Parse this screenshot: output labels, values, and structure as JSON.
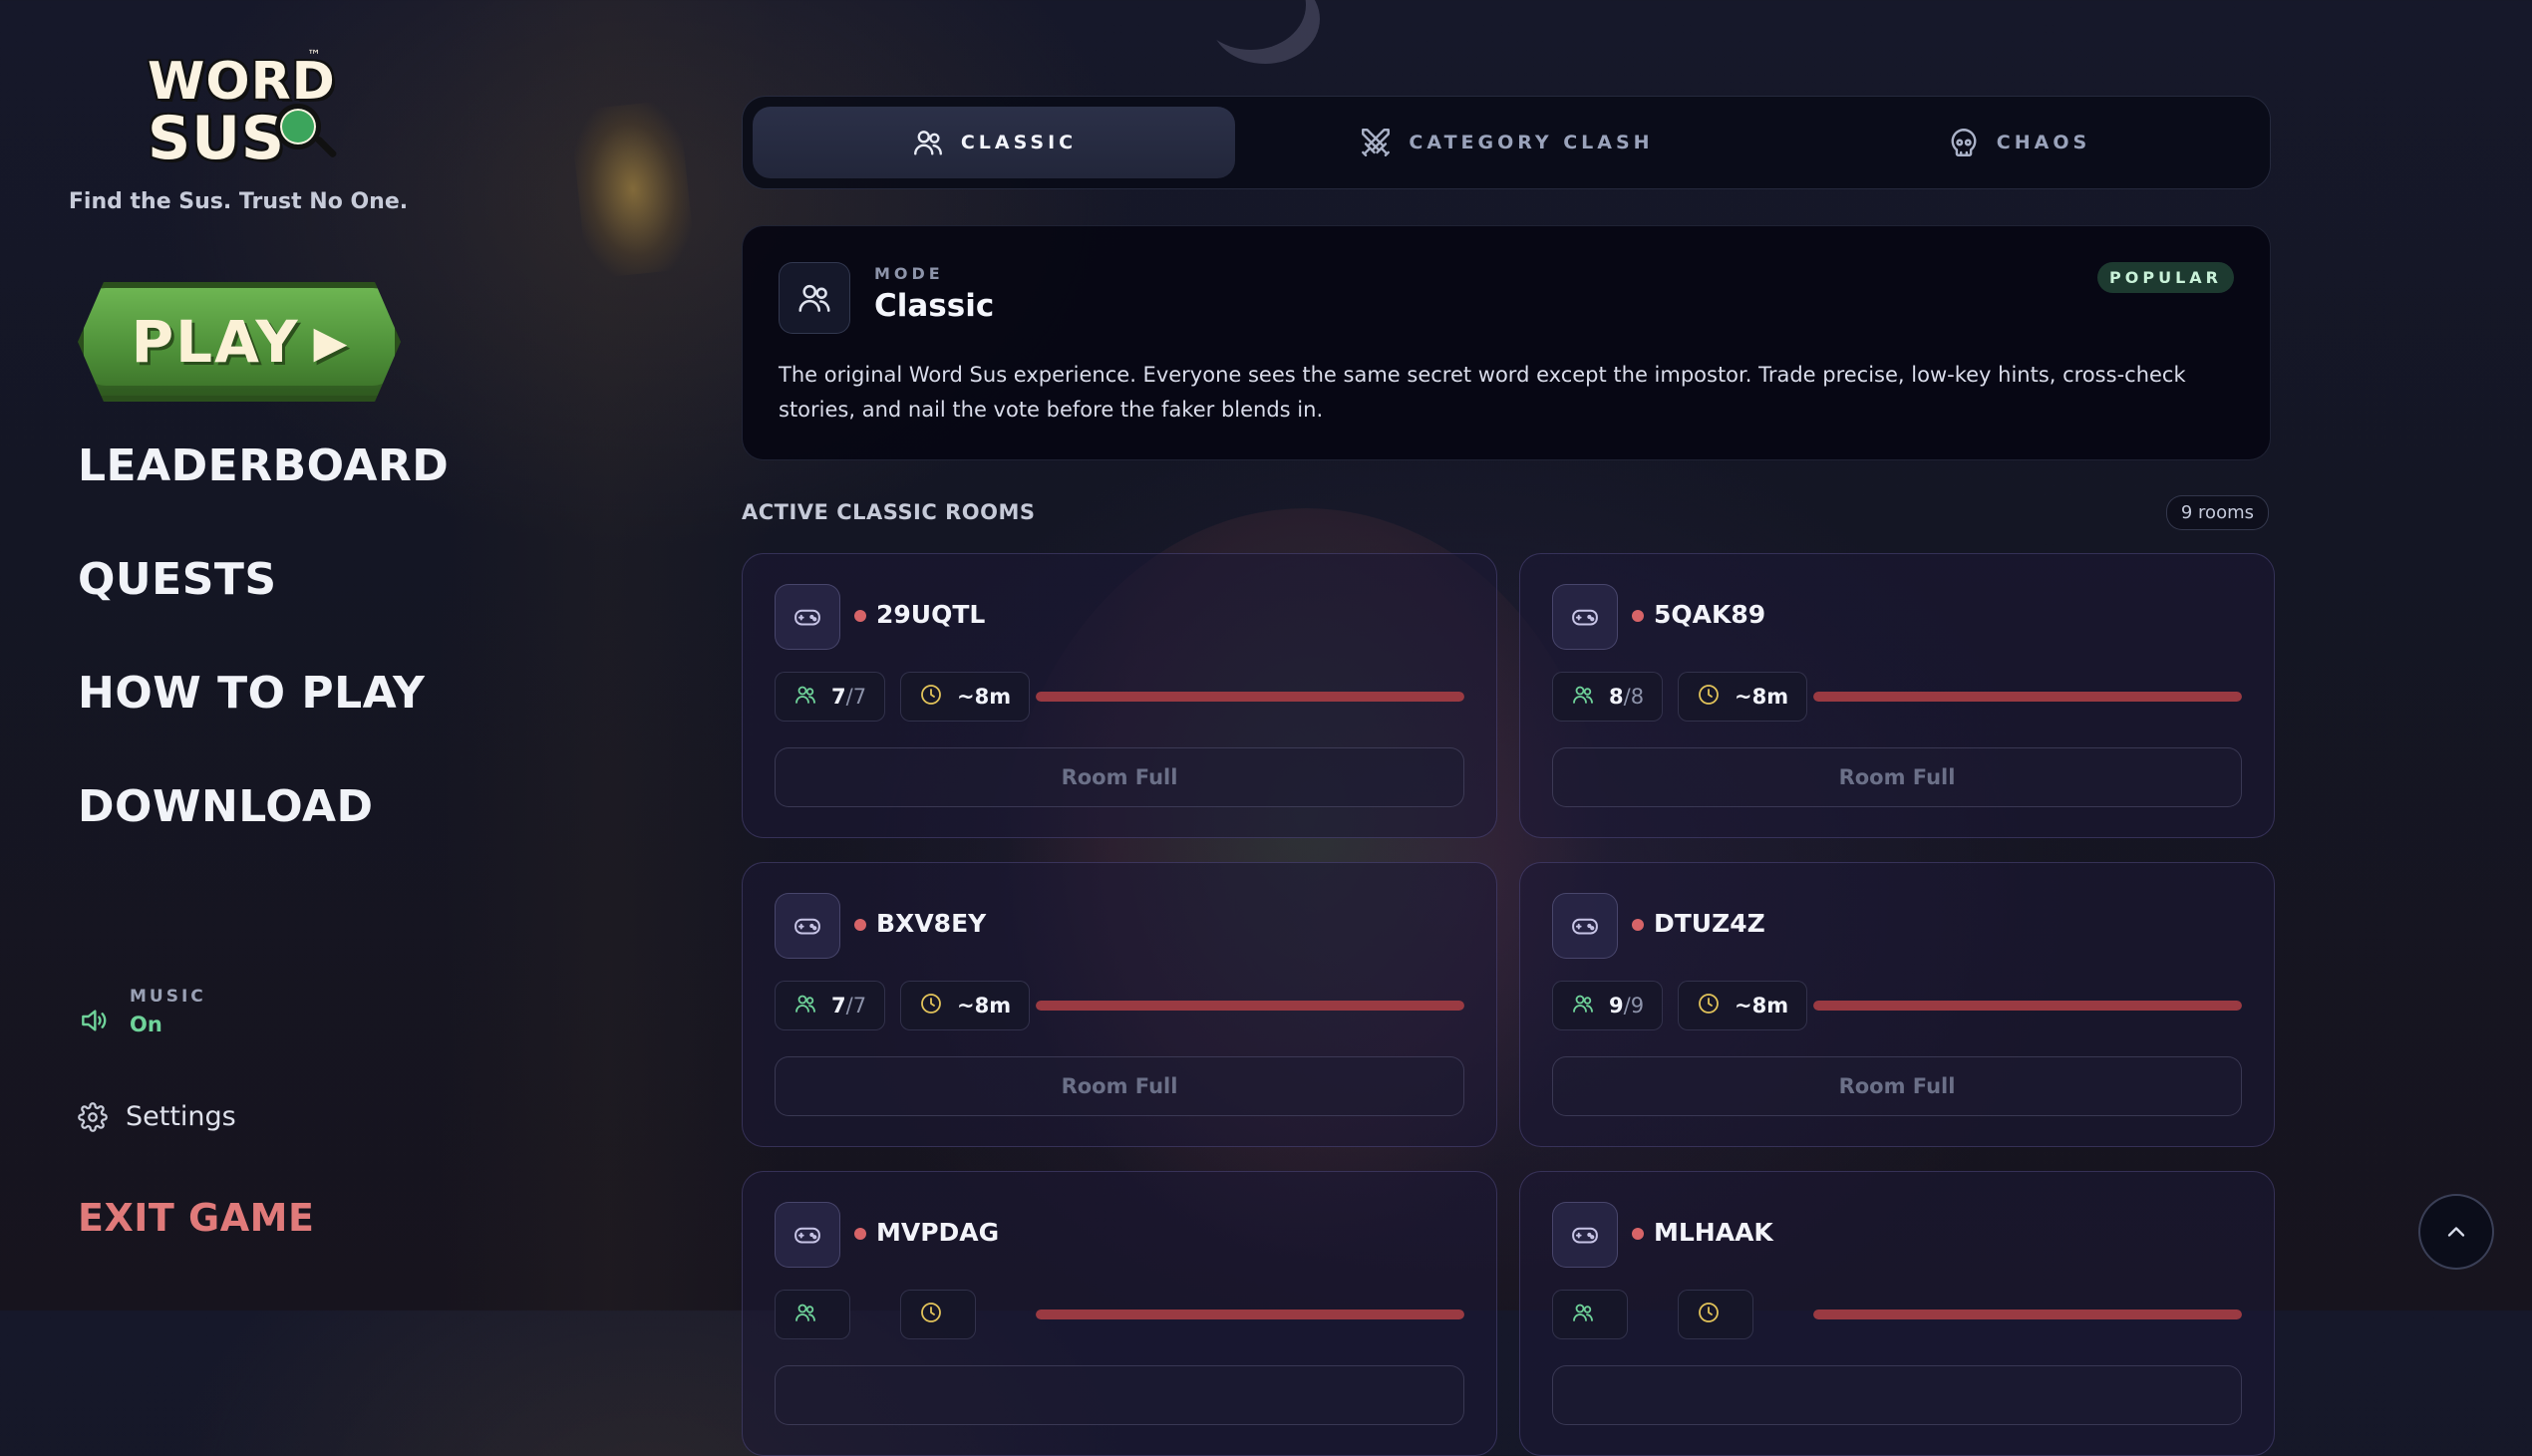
{
  "brand": {
    "logo_line1": "WORD",
    "logo_line2": "SUS",
    "tagline": "Find the Sus. Trust No One."
  },
  "sidebar": {
    "play_label": "PLAY",
    "nav": [
      {
        "label": "LEADERBOARD"
      },
      {
        "label": "QUESTS"
      },
      {
        "label": "HOW TO PLAY"
      },
      {
        "label": "DOWNLOAD"
      }
    ],
    "music": {
      "label": "MUSIC",
      "value": "On"
    },
    "settings_label": "Settings",
    "exit_label": "EXIT GAME"
  },
  "tabs": [
    {
      "label": "CLASSIC",
      "icon": "users-icon",
      "active": true
    },
    {
      "label": "CATEGORY CLASH",
      "icon": "crossed-swords-icon",
      "active": false
    },
    {
      "label": "CHAOS",
      "icon": "skull-icon",
      "active": false
    }
  ],
  "mode": {
    "kicker": "MODE",
    "title": "Classic",
    "badge": "POPULAR",
    "description": "The original Word Sus experience. Everyone sees the same secret word except the impostor. Trade precise, low-key hints, cross-check stories, and nail the vote before the faker blends in."
  },
  "rooms_section": {
    "title": "ACTIVE CLASSIC ROOMS",
    "count": "9 rooms",
    "rooms": [
      {
        "code": "29UQTL",
        "players": "7",
        "max": "/7",
        "time": "~8m",
        "fill": 1.0,
        "action": "Room Full"
      },
      {
        "code": "5QAK89",
        "players": "8",
        "max": "/8",
        "time": "~8m",
        "fill": 1.0,
        "action": "Room Full"
      },
      {
        "code": "BXV8EY",
        "players": "7",
        "max": "/7",
        "time": "~8m",
        "fill": 1.0,
        "action": "Room Full"
      },
      {
        "code": "DTUZ4Z",
        "players": "9",
        "max": "/9",
        "time": "~8m",
        "fill": 1.0,
        "action": "Room Full"
      },
      {
        "code": "MVPDAG",
        "players": "",
        "max": "",
        "time": "",
        "fill": 1.0,
        "action": ""
      },
      {
        "code": "MLHAAK",
        "players": "",
        "max": "",
        "time": "",
        "fill": 1.0,
        "action": ""
      }
    ]
  },
  "colors": {
    "accent_green": "#6fd39a",
    "exit_red": "#e07a7a",
    "room_dot": "#d76468",
    "fill_red": "#9a3a42"
  }
}
